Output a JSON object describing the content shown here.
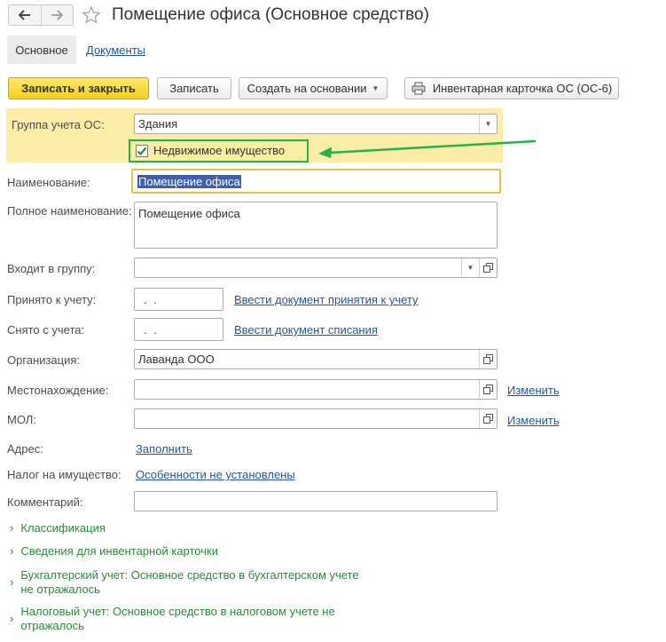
{
  "header": {
    "title": "Помещение офиса (Основное средство)"
  },
  "tabs": {
    "main": "Основное",
    "documents": "Документы"
  },
  "toolbar": {
    "write_close": "Записать и закрыть",
    "write": "Записать",
    "create_based": "Создать на основании",
    "inventory_card": "Инвентарная карточка ОС (ОС-6)"
  },
  "form": {
    "group_label": "Группа учета ОС:",
    "group_value": "Здания",
    "real_estate_label": "Недвижимое имущество",
    "real_estate_checked": true,
    "name_label": "Наименование:",
    "name_value": "Помещение офиса",
    "full_name_label": "Полное наименование:",
    "full_name_value": "Помещение офиса",
    "parent_group_label": "Входит в группу:",
    "parent_group_value": "",
    "accepted_label": "Принято к учету:",
    "accepted_value": " .  .",
    "accepted_link": "Ввести документ принятия к учету",
    "removed_label": "Снято с учета:",
    "removed_value": " .  .",
    "removed_link": "Ввести документ списания",
    "organization_label": "Организация:",
    "organization_value": "Лаванда ООО",
    "location_label": "Местонахождение:",
    "location_value": "",
    "location_link": "Изменить",
    "mol_label": "МОЛ:",
    "mol_value": "",
    "mol_link": "Изменить",
    "address_label": "Адрес:",
    "address_link": "Заполнить",
    "tax_label": "Налог на имущество:",
    "tax_link": "Особенности не установлены",
    "comment_label": "Комментарий:",
    "comment_value": ""
  },
  "sections": [
    {
      "line1": "Классификация",
      "line2": ""
    },
    {
      "line1": "Сведения для инвентарной карточки",
      "line2": ""
    },
    {
      "line1": "Бухгалтерский учет: Основное средство в бухгалтерском учете",
      "line2": "не отражалось"
    },
    {
      "line1": "Налоговый учет: Основное средство в налоговом учете не",
      "line2": "отражалось"
    }
  ],
  "colors": {
    "accent_yellow": "#f6cf1e",
    "group_background": "#fbeca6",
    "link_blue": "#2455a4",
    "section_green": "#2b8a3b",
    "highlight_green": "#24b24b"
  },
  "icons": [
    "back-arrow-icon",
    "forward-arrow-icon",
    "favorite-star-icon",
    "print-icon",
    "dropdown-arrow-icon",
    "open-form-icon",
    "checkmark-icon",
    "chevron-right-icon",
    "annotation-arrow-icon"
  ]
}
